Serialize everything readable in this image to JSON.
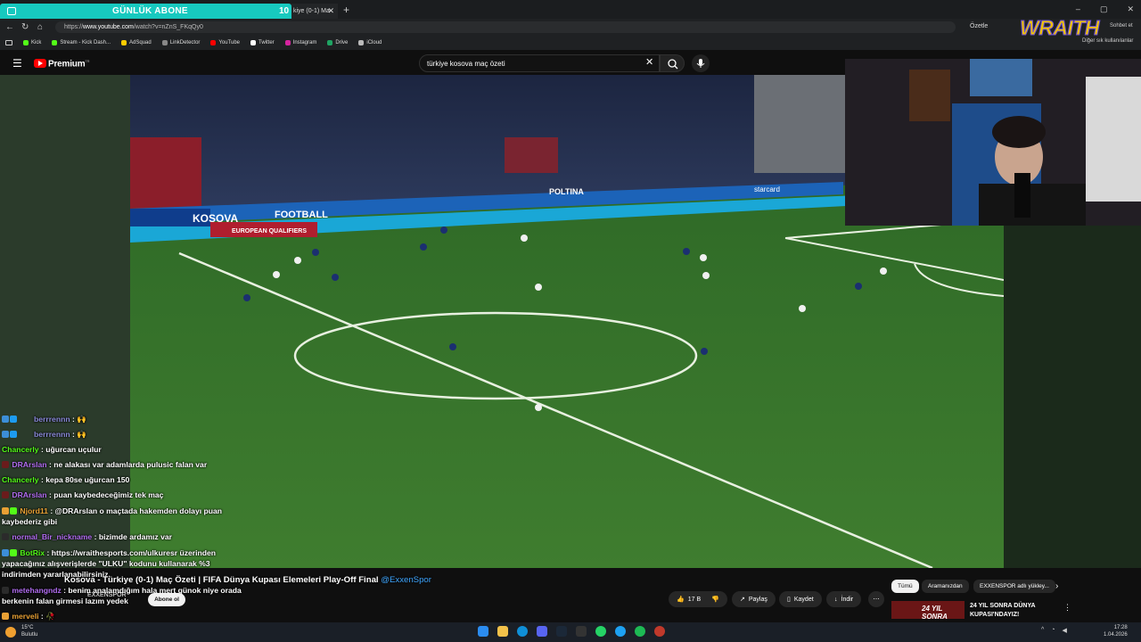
{
  "browser": {
    "banner_label": "GÜNLÜK ABONE",
    "banner_count": "10",
    "tab_title": "kiye (0-1) Ma",
    "url_prefix": "https://",
    "url_host": "www.youtube.com",
    "url_path": "/watch?v=nZnS_FKqQy0",
    "summarize_label": "Özetle",
    "chat_label": "Sohbet et",
    "bookmarks": [
      {
        "label": "Kick",
        "color": "#53fc18"
      },
      {
        "label": "Stream - Kick Dash...",
        "color": "#53fc18"
      },
      {
        "label": "AdSquad",
        "color": "#ffcc00"
      },
      {
        "label": "LinkDetector",
        "color": "#888888"
      },
      {
        "label": "YouTube",
        "color": "#ff0000"
      },
      {
        "label": "Twitter",
        "color": "#ffffff"
      },
      {
        "label": "Instagram",
        "color": "#d6249f"
      },
      {
        "label": "Drive",
        "color": "#1fa463"
      },
      {
        "label": "iCloud",
        "color": "#bbbbbb"
      }
    ],
    "kick_bookmark_right": "Diğer sık kullanılanlar"
  },
  "youtube": {
    "logo_text": "Premium",
    "logo_sup": "TR",
    "search_query": "türkiye kosova maç özeti"
  },
  "overlay": {
    "brand": "WRAITH"
  },
  "chat": [
    {
      "user": "berrrennn",
      "text": ": 🙌",
      "color": "#8a8ad8",
      "badge": "#3c8ed8"
    },
    {
      "user": "berrrennn",
      "text": ": 🙌",
      "color": "#8a8ad8",
      "badge": "#3c8ed8"
    },
    {
      "user": "Chancerly",
      "text": ": uğurcan uçulur",
      "color": "#53fc18",
      "badge": ""
    },
    {
      "user": "DRArslan",
      "text": ": ne alakası var adamlarda pulusic falan var",
      "color": "#b16cf0",
      "badge": "#6a1c1c"
    },
    {
      "user": "Chancerly",
      "text": ": kepa 80se uğurcan 150",
      "color": "#53fc18",
      "badge": ""
    },
    {
      "user": "DRArslan",
      "text": ": puan kaybedeceğimiz tek maç",
      "color": "#b16cf0",
      "badge": "#6a1c1c"
    },
    {
      "user": "Njord11",
      "text": ": @DRArslan o maçtada hakemden dolayı puan kaybederiz gibi",
      "color": "#e8a034",
      "badge": "#e8a034",
      "wrap": true
    },
    {
      "user": "normal_Bir_nickname",
      "text": ": bizimde ardamız var",
      "color": "#b16cf0",
      "badge": "#2b2b2b"
    },
    {
      "user": "BotRix",
      "text": ": https://wraithesports.com/ulkuresr üzerinden yapacağınız alışverişlerde \"ULKU\" kodunu kullanarak %3 indirimden yararlanabilirsiniz.",
      "color": "#53fc18",
      "badge": "#3c8ed8",
      "wrap": true
    },
    {
      "user": "metehangndz",
      "text": ": benim analamdığım hala mert günok niye orada berkenin falan girmesi lazım yedek",
      "color": "#b16cf0",
      "badge": "#2b2b2b",
      "wrap": true
    },
    {
      "user": "merveli",
      "text": ": 🥀",
      "color": "#e8a034",
      "badge": "#e8a034"
    }
  ],
  "video": {
    "title": "Kosova - Türkiye (0-1) Maç Özeti | FIFA Dünya Kupası Elemeleri Play-Off Final",
    "title_link": "@ExxenSpor",
    "channel": "EXXENSPOR",
    "subscribe_label": "Abone ol",
    "likes": "17 B",
    "share_label": "Paylaş",
    "save_label": "Kaydet",
    "download_label": "İndir",
    "pitch_banner_left": "KOSOVA",
    "pitch_banner_football": "FOOTBALL",
    "pitch_banner_eq": "EUROPEAN QUALIFIERS",
    "pitch_banner_sponsor": "starcard",
    "pitch_banner_top": "POLTINA"
  },
  "sidebar": {
    "chips": [
      "Tümü",
      "Aramanızdan",
      "EXXENSPOR adlı yükley..."
    ],
    "rec_thumb_text": "24 YIL SONRA",
    "rec_title_line1": "24 YIL SONRA DÜNYA",
    "rec_title_line2": "KUPASI'NDAYIZ!"
  },
  "taskbar": {
    "temp": "15°C",
    "weather": "Bulutlu",
    "time": "17:28",
    "date": "1.04.2026"
  }
}
